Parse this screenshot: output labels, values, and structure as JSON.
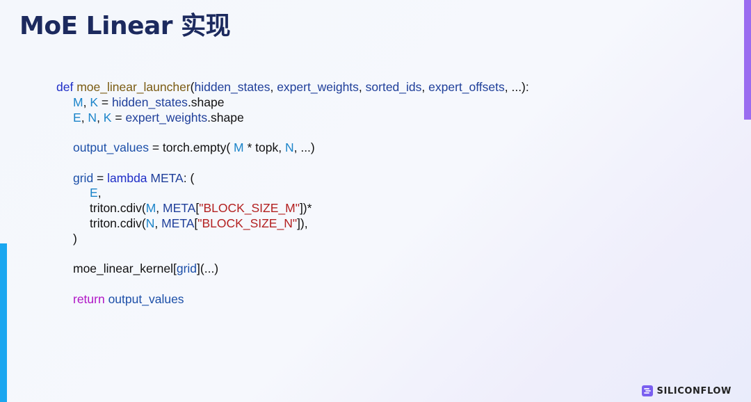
{
  "slide": {
    "title": "MoE Linear 实现",
    "brand": "SILICONFLOW",
    "accent_left_color": "#1aa7f0",
    "accent_right_color": "#9a6cf0",
    "title_color": "#1c2a5e"
  },
  "code": {
    "lines": [
      {
        "indent": 0,
        "tokens": [
          {
            "t": "def ",
            "c": "kw"
          },
          {
            "t": "moe_linear_launcher",
            "c": "fn"
          },
          {
            "t": "(",
            "c": "plain"
          },
          {
            "t": "hidden_states",
            "c": "param"
          },
          {
            "t": ", ",
            "c": "plain"
          },
          {
            "t": "expert_weights",
            "c": "param"
          },
          {
            "t": ", ",
            "c": "plain"
          },
          {
            "t": "sorted_ids",
            "c": "param"
          },
          {
            "t": ", ",
            "c": "plain"
          },
          {
            "t": "expert_offsets",
            "c": "param"
          },
          {
            "t": ", ...):",
            "c": "plain"
          }
        ]
      },
      {
        "indent": 1,
        "tokens": [
          {
            "t": "M",
            "c": "num"
          },
          {
            "t": ", ",
            "c": "plain"
          },
          {
            "t": "K",
            "c": "num"
          },
          {
            "t": " = ",
            "c": "plain"
          },
          {
            "t": "hidden_states",
            "c": "param"
          },
          {
            "t": ".shape",
            "c": "plain"
          }
        ]
      },
      {
        "indent": 1,
        "tokens": [
          {
            "t": "E",
            "c": "num"
          },
          {
            "t": ", ",
            "c": "plain"
          },
          {
            "t": "N",
            "c": "num"
          },
          {
            "t": ", ",
            "c": "plain"
          },
          {
            "t": "K",
            "c": "num"
          },
          {
            "t": " = ",
            "c": "plain"
          },
          {
            "t": "expert_weights",
            "c": "param"
          },
          {
            "t": ".shape",
            "c": "plain"
          }
        ]
      },
      {
        "indent": 1,
        "tokens": []
      },
      {
        "indent": 1,
        "tokens": [
          {
            "t": "output_values",
            "c": "var"
          },
          {
            "t": " = torch.empty( ",
            "c": "plain"
          },
          {
            "t": "M",
            "c": "num"
          },
          {
            "t": " * topk, ",
            "c": "plain"
          },
          {
            "t": "N",
            "c": "num"
          },
          {
            "t": ", ...)",
            "c": "plain"
          }
        ]
      },
      {
        "indent": 1,
        "tokens": []
      },
      {
        "indent": 1,
        "tokens": [
          {
            "t": "grid",
            "c": "var"
          },
          {
            "t": " = ",
            "c": "plain"
          },
          {
            "t": "lambda ",
            "c": "kw"
          },
          {
            "t": "META",
            "c": "param"
          },
          {
            "t": ": (",
            "c": "plain"
          }
        ]
      },
      {
        "indent": 2,
        "tokens": [
          {
            "t": "E",
            "c": "num"
          },
          {
            "t": ",",
            "c": "plain"
          }
        ]
      },
      {
        "indent": 2,
        "tokens": [
          {
            "t": "triton.cdiv(",
            "c": "plain"
          },
          {
            "t": "M",
            "c": "num"
          },
          {
            "t": ", ",
            "c": "plain"
          },
          {
            "t": "META",
            "c": "param"
          },
          {
            "t": "[",
            "c": "plain"
          },
          {
            "t": "\"BLOCK_SIZE_M\"",
            "c": "str"
          },
          {
            "t": "])*",
            "c": "plain"
          }
        ]
      },
      {
        "indent": 2,
        "tokens": [
          {
            "t": "triton.cdiv(",
            "c": "plain"
          },
          {
            "t": "N",
            "c": "num"
          },
          {
            "t": ", ",
            "c": "plain"
          },
          {
            "t": "META",
            "c": "param"
          },
          {
            "t": "[",
            "c": "plain"
          },
          {
            "t": "\"BLOCK_SIZE_N\"",
            "c": "str"
          },
          {
            "t": "]),",
            "c": "plain"
          }
        ]
      },
      {
        "indent": 1,
        "tokens": [
          {
            "t": ")",
            "c": "plain"
          }
        ]
      },
      {
        "indent": 1,
        "tokens": []
      },
      {
        "indent": 1,
        "tokens": [
          {
            "t": "moe_linear_kernel[",
            "c": "plain"
          },
          {
            "t": "grid",
            "c": "var"
          },
          {
            "t": "](...)",
            "c": "plain"
          }
        ]
      },
      {
        "indent": 1,
        "tokens": []
      },
      {
        "indent": 1,
        "tokens": [
          {
            "t": "return ",
            "c": "ret"
          },
          {
            "t": "output_values",
            "c": "var"
          }
        ]
      }
    ]
  }
}
